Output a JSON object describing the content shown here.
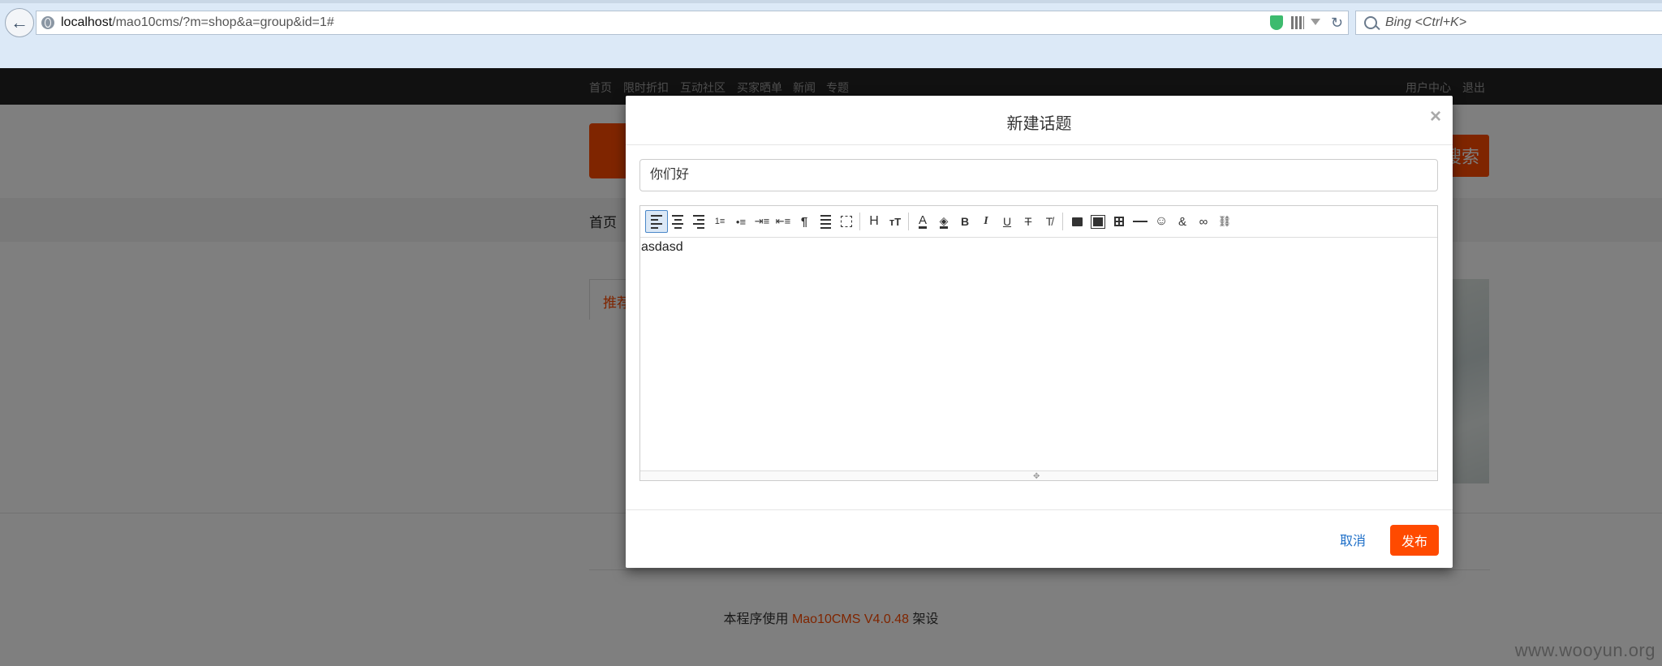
{
  "browser": {
    "url_host": "localhost",
    "url_path": "/mao10cms/?m=shop&a=group&id=1#",
    "search_placeholder": "Bing <Ctrl+K>"
  },
  "topnav": {
    "left": [
      "首页",
      "限时折扣",
      "互动社区",
      "买家晒单",
      "新闻",
      "专题"
    ],
    "right": [
      "用户中心",
      "退出"
    ]
  },
  "header": {
    "search_button": "搜索"
  },
  "mainnav": {
    "home": "首页"
  },
  "tab": {
    "label": "推荐"
  },
  "footer": {
    "prefix": "本程序使用 ",
    "link": "Mao10CMS V4.0.48",
    "suffix": " 架设"
  },
  "watermark": "www.wooyun.org",
  "modal": {
    "title": "新建话题",
    "close_symbol": "×",
    "title_input_value": "你们好",
    "editor_content": "asdasd",
    "cancel_label": "取消",
    "publish_label": "发布",
    "toolbar": [
      "align-left",
      "align-center",
      "align-right",
      "ordered-list",
      "unordered-list",
      "indent",
      "outdent",
      "format-painter",
      "justify",
      "select-all",
      "heading",
      "font-size",
      "font-color",
      "background-color",
      "bold",
      "italic",
      "underline",
      "strikethrough",
      "clear-format",
      "image",
      "multi-image",
      "table",
      "horizontal-rule",
      "emoji",
      "special-char",
      "link",
      "unlink"
    ]
  },
  "colors": {
    "accent": "#ff4a00",
    "link_blue": "#1e6fc8",
    "topnav_bg": "#222222"
  }
}
